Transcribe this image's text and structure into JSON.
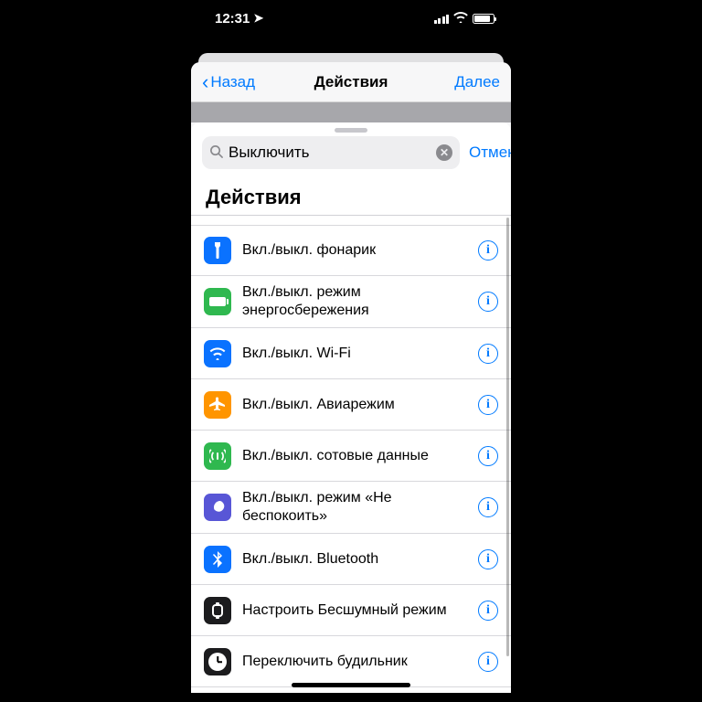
{
  "status": {
    "time": "12:31"
  },
  "nav": {
    "back": "Назад",
    "title": "Действия",
    "next": "Далее"
  },
  "search": {
    "value": "Выключить",
    "cancel": "Отменить"
  },
  "section": {
    "title": "Действия"
  },
  "rows": [
    {
      "label": "Вкл./выкл. фонарик",
      "icon": "flashlight"
    },
    {
      "label": "Вкл./выкл. режим энергосбережения",
      "icon": "lowpower"
    },
    {
      "label": "Вкл./выкл. Wi-Fi",
      "icon": "wifi"
    },
    {
      "label": "Вкл./выкл. Авиарежим",
      "icon": "airplane"
    },
    {
      "label": "Вкл./выкл. сотовые данные",
      "icon": "cellular"
    },
    {
      "label": "Вкл./выкл. режим «Не беспокоить»",
      "icon": "dnd"
    },
    {
      "label": "Вкл./выкл. Bluetooth",
      "icon": "bluetooth"
    },
    {
      "label": "Настроить Бесшумный режим",
      "icon": "watch"
    },
    {
      "label": "Переключить будильник",
      "icon": "clock"
    }
  ]
}
